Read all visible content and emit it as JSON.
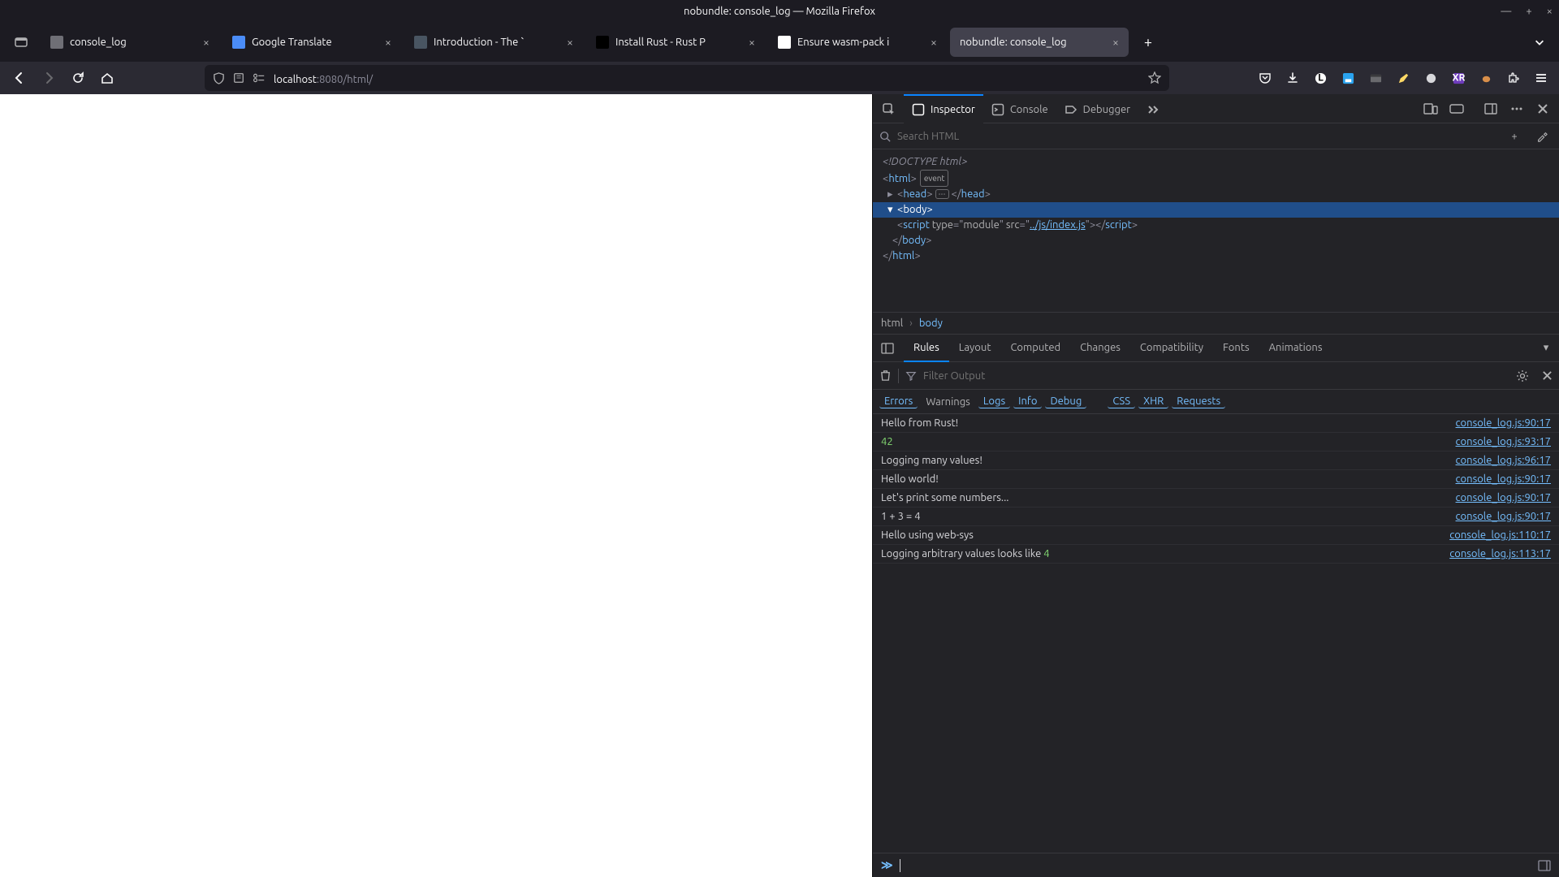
{
  "window": {
    "title": "nobundle: console_log — Mozilla Firefox"
  },
  "tabs": [
    {
      "title": "console_log"
    },
    {
      "title": "Google Translate"
    },
    {
      "title": "Introduction - The `"
    },
    {
      "title": "Install Rust - Rust P"
    },
    {
      "title": "Ensure wasm-pack i"
    },
    {
      "title": "nobundle: console_log"
    }
  ],
  "url": {
    "host": "localhost",
    "rest": ":8080/html/"
  },
  "devtools": {
    "tabs": {
      "inspector": "Inspector",
      "console": "Console",
      "debugger": "Debugger"
    },
    "search_placeholder": "Search HTML",
    "breadcrumb": {
      "a": "html",
      "b": "body"
    },
    "panel_tabs": [
      "Rules",
      "Layout",
      "Computed",
      "Changes",
      "Compatibility",
      "Fonts",
      "Animations"
    ],
    "filter_placeholder": "Filter Output",
    "categories": [
      "Errors",
      "Warnings",
      "Logs",
      "Info",
      "Debug",
      "CSS",
      "XHR",
      "Requests"
    ],
    "markup": {
      "doctype": "<!DOCTYPE html>",
      "html_open": "html",
      "event": "event",
      "head_open": "head",
      "head_close": "head",
      "body_open": "body",
      "script_tag": "script",
      "type_attr": "type",
      "type_val": "module",
      "src_attr": "src",
      "src_val": "../js/index.js",
      "body_close": "body",
      "html_close": "html"
    },
    "console": {
      "entries": [
        {
          "msg": "Hello from Rust!",
          "src": "console_log.js:90:17"
        },
        {
          "msg": "42",
          "num": true,
          "src": "console_log.js:93:17"
        },
        {
          "msg": "Logging many values!",
          "src": "console_log.js:96:17"
        },
        {
          "msg": "Hello world!",
          "src": "console_log.js:90:17"
        },
        {
          "msg": "Let's print some numbers...",
          "src": "console_log.js:90:17"
        },
        {
          "msg": "1 + 3 = 4",
          "src": "console_log.js:90:17"
        },
        {
          "msg": "Hello using web-sys",
          "src": "console_log.js:110:17"
        },
        {
          "msg_pre": "Logging arbitrary values looks like ",
          "msg_num": "4",
          "src": "console_log.js:113:17"
        }
      ]
    }
  }
}
